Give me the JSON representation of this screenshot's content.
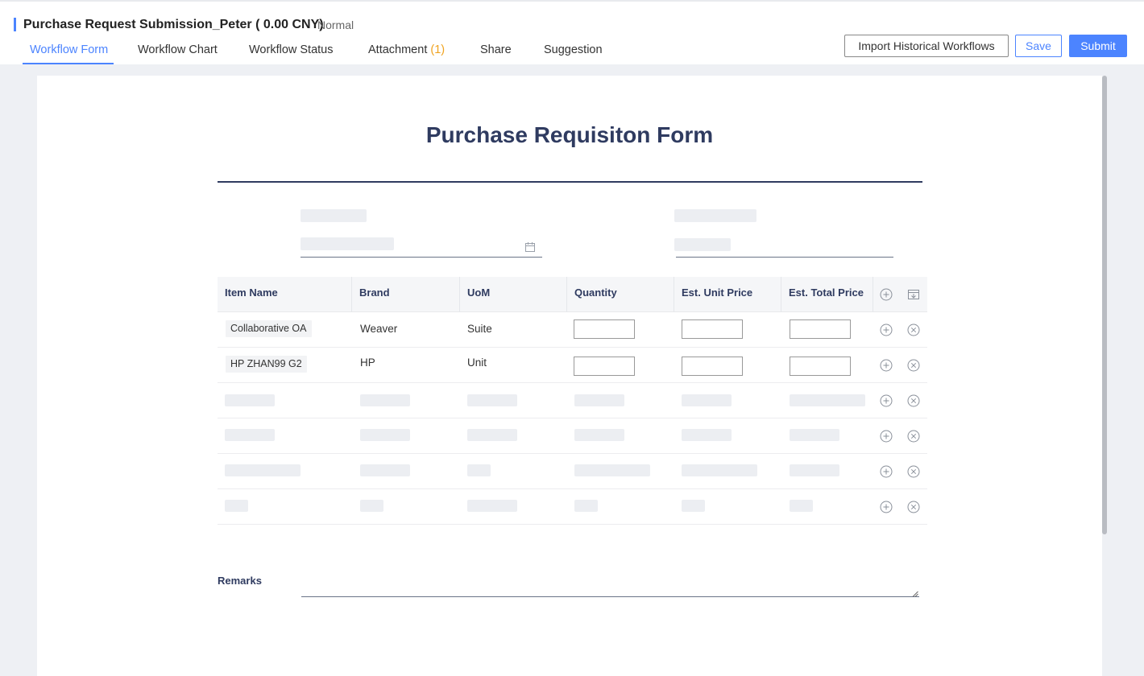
{
  "header": {
    "title": "Purchase Request Submission_Peter ( 0.00 CNY)",
    "level": "Normal"
  },
  "tabs": [
    {
      "label": "Workflow Form",
      "active": true
    },
    {
      "label": "Workflow Chart"
    },
    {
      "label": "Workflow Status"
    },
    {
      "label": "Attachment",
      "count": "(1)"
    },
    {
      "label": "Share"
    },
    {
      "label": "Suggestion"
    }
  ],
  "actions": {
    "import_label": "Import Historical Workflows",
    "save_label": "Save",
    "submit_label": "Submit"
  },
  "form": {
    "title": "Purchase Requisiton Form",
    "table": {
      "headers": [
        "Item Name",
        "Brand",
        "UoM",
        "Quantity",
        "Est. Unit Price",
        "Est. Total Price"
      ],
      "rows": [
        {
          "item": "Collaborative OA",
          "brand": "Weaver",
          "uom": "Suite",
          "quantity": "",
          "unit_price": "",
          "total_price": ""
        },
        {
          "item": "HP ZHAN99 G2",
          "brand": "HP",
          "uom": "Unit",
          "quantity": "",
          "unit_price": "",
          "total_price": ""
        }
      ]
    },
    "remarks_label": "Remarks",
    "remarks_value": ""
  },
  "colors": {
    "accent": "#4c84ff",
    "title_navy": "#2f3b60",
    "count_orange": "#f0a320"
  },
  "icons": [
    "calendar-icon",
    "add-row-icon",
    "import-row-icon",
    "add-circle-icon",
    "remove-circle-icon"
  ]
}
